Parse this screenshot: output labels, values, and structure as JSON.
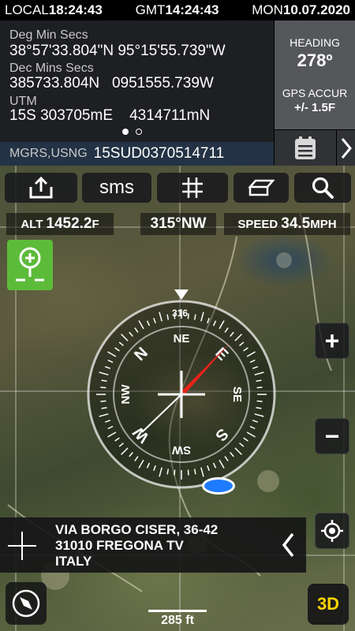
{
  "status": {
    "local_label": "LOCAL",
    "local_time": "18:24:43",
    "gmt_label": "GMT",
    "gmt_time": "14:24:43",
    "day": "MON",
    "date": "10.07.2020"
  },
  "coords": {
    "dms_label": "Deg Min Secs",
    "dms_value": "38°57'33.804\"N 95°15'55.739\"W",
    "dm_label": "Dec Mins Secs",
    "dm_value": "385733.804N   0951555.739W",
    "utm_label": "UTM",
    "utm_value": "15S 303705mE    4314711mN",
    "mgrs_label": "MGRS,USNG",
    "mgrs_value": "15SUD0370514711",
    "page_count": 2,
    "page_index": 0
  },
  "heading_panel": {
    "heading_label": "HEADING",
    "heading_value": "278º",
    "gps_label": "GPS ACCUR",
    "gps_value": "+/- 1.5F"
  },
  "toolbar": {
    "share_icon": "share-icon",
    "sms_label": "sms",
    "grid_icon": "grid-icon",
    "map_type_icon": "map-layers-icon",
    "search_icon": "search-icon"
  },
  "stats": {
    "alt_label": "ALT",
    "alt_value": "1452.2",
    "alt_unit": "F",
    "bearing": "315°NW",
    "speed_label": "SPEED",
    "speed_value": "34.5",
    "speed_unit": "MPH"
  },
  "compass": {
    "cardinals": [
      "N",
      "NE",
      "E",
      "SE",
      "S",
      "SW",
      "W",
      "NW"
    ],
    "top_reading": "316"
  },
  "address": {
    "line1": "VIA BORGO CISER, 36-42",
    "line2": "31010 FREGONA TV",
    "line3": "ITALY"
  },
  "map": {
    "scale_label": "285 ft",
    "mode_button": "3D",
    "zoom_in": "+",
    "zoom_out": "−"
  },
  "colors": {
    "accent_green": "#5dbb3a",
    "mode_yellow": "#ffd400",
    "gps_blue": "#1e7bff",
    "needle_red": "#e8231c"
  }
}
